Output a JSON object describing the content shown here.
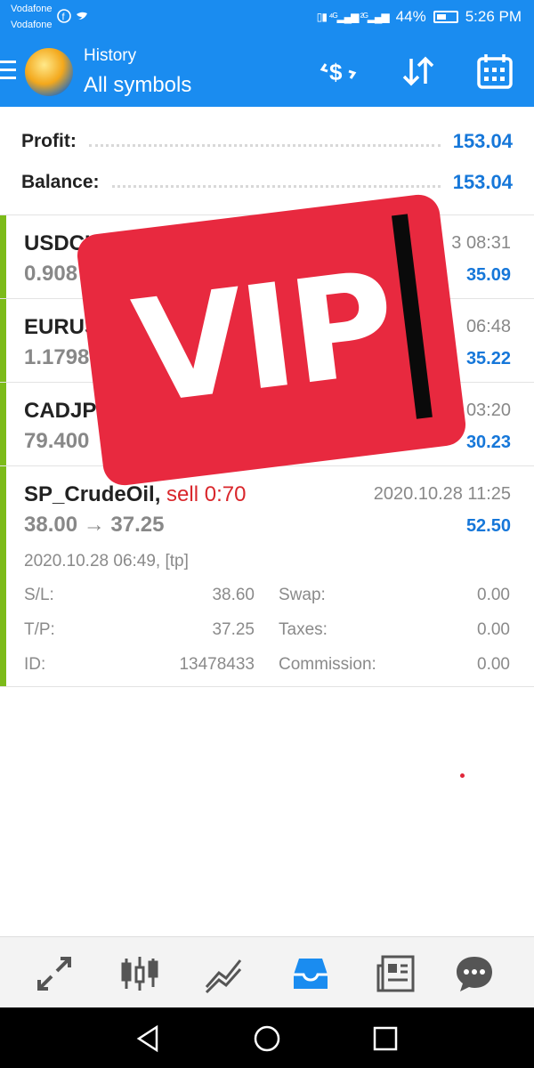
{
  "status_bar": {
    "carrier_1": "Vodafone",
    "carrier_2": "Vodafone",
    "battery": "44%",
    "time": "5:26 PM"
  },
  "header": {
    "title": "History",
    "subtitle": "All symbols",
    "icons": [
      "currency-exchange-icon",
      "sort-icon",
      "calendar-icon"
    ]
  },
  "summary": {
    "profit_label": "Profit:",
    "profit_value": "153.04",
    "balance_label": "Balance:",
    "balance_value": "153.04"
  },
  "trades": [
    {
      "symbol": "USDCH",
      "prices": "0.908",
      "date": "3 08:31",
      "profit": "35.09"
    },
    {
      "symbol": "EURUS",
      "prices": "1.1798",
      "date": "06:48",
      "profit": "35.22"
    },
    {
      "symbol": "CADJP",
      "prices": "79.400",
      "date": "03:20",
      "profit": "30.23"
    },
    {
      "symbol": "SP_CrudeOil,",
      "side": "sell 0:70",
      "prices": "38.00 → 37.25",
      "date": "2020.10.28 11:25",
      "profit": "52.50",
      "opened": "2020.10.28 06:49, [tp]",
      "details": {
        "sl_label": "S/L:",
        "sl_value": "38.60",
        "swap_label": "Swap:",
        "swap_value": "0.00",
        "tp_label": "T/P:",
        "tp_value": "37.25",
        "taxes_label": "Taxes:",
        "taxes_value": "0.00",
        "id_label": "ID:",
        "id_value": "13478433",
        "commission_label": "Commission:",
        "commission_value": "0.00"
      }
    }
  ],
  "overlay": {
    "text": "VIP"
  },
  "bottom_nav": [
    "trade-icon",
    "chart-candles-icon",
    "trend-icon",
    "history-inbox-icon",
    "news-icon",
    "chat-icon"
  ],
  "colors": {
    "primary": "#1a8cf0",
    "profit": "#1677d9",
    "sell": "#d9262b",
    "accent_bar": "#7cbb1a",
    "overlay": "#e8293f"
  }
}
